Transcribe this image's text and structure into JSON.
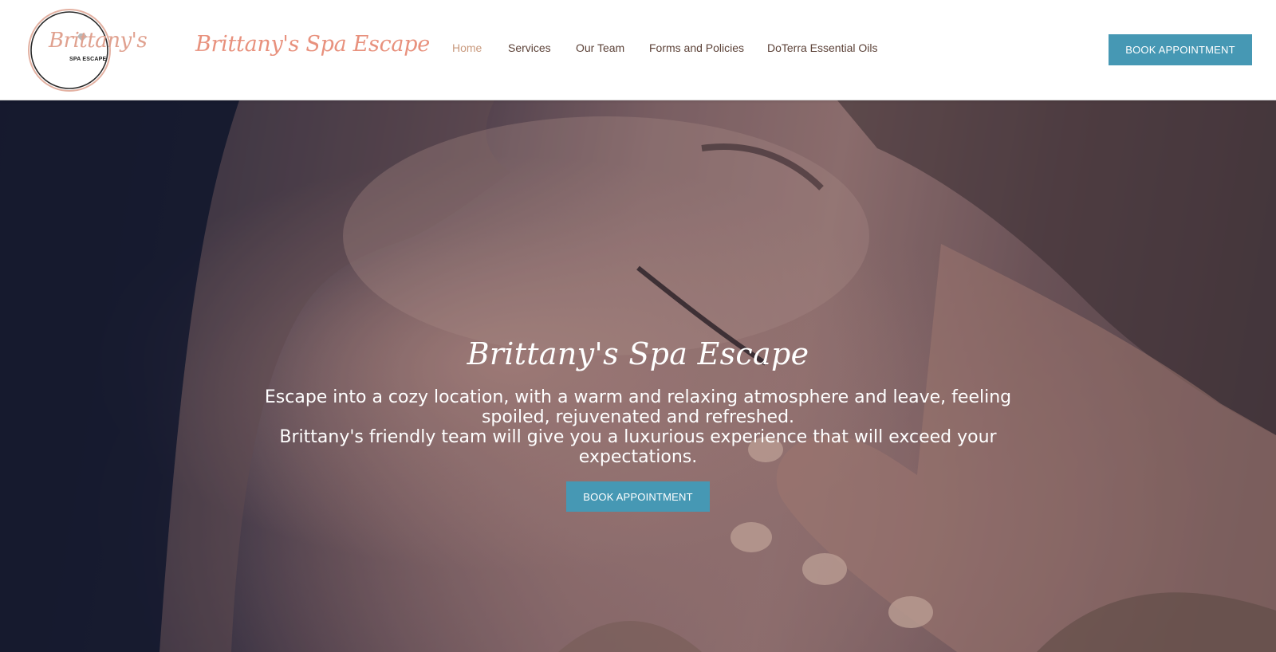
{
  "header": {
    "logo": {
      "script_text": "Brittany's",
      "sub_text": "SPA ESCAPE",
      "icon": "diamond-icon"
    },
    "brand_name": "Brittany's Spa Escape",
    "nav": [
      {
        "label": "Home",
        "active": true
      },
      {
        "label": "Services",
        "active": false
      },
      {
        "label": "Our Team",
        "active": false
      },
      {
        "label": "Forms and Policies",
        "active": false
      },
      {
        "label": "DoTerra Essential Oils",
        "active": false
      }
    ],
    "book_button_label": "BOOK APPOINTMENT"
  },
  "hero": {
    "title": "Brittany's Spa Escape",
    "paragraph_1": "Escape into a cozy location, with a warm and relaxing atmosphere and leave, feeling spoiled, rejuvenated and refreshed.",
    "paragraph_2": "Brittany's friendly team will give you a luxurious experience that will exceed your expectations.",
    "book_button_label": "BOOK APPOINTMENT"
  },
  "colors": {
    "accent_button": "#4698b4",
    "brand_script": "#e8917d",
    "nav_text": "#5c4238",
    "nav_active": "#c99a7e"
  }
}
